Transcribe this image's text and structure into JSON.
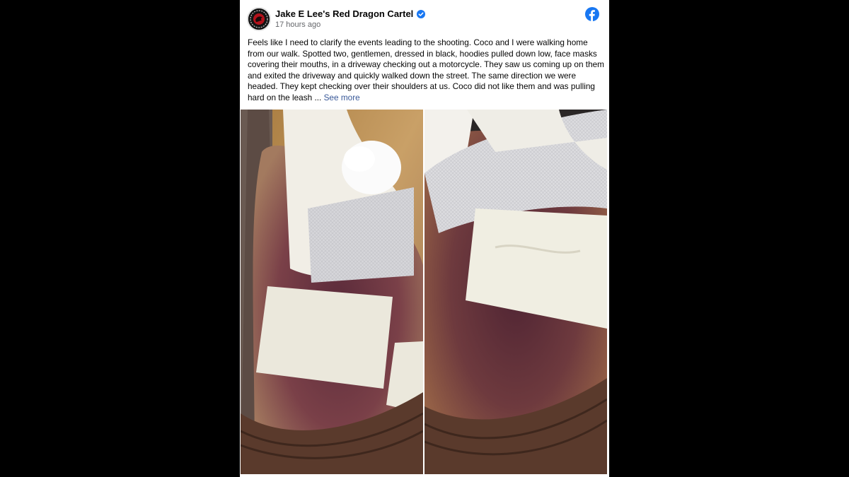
{
  "post": {
    "author": "Jake E Lee's Red Dragon Cartel",
    "timestamp": "17 hours ago",
    "text": "Feels like I need to clarify the events leading to the shooting. Coco and I were walking home from our walk. Spotted two, gentlemen, dressed in black, hoodies pulled down low, face masks covering their mouths, in a driveway checking out a motorcycle. They saw us coming up on them and exited the driveway and quickly walked down the street. The same direction we were headed. They kept checking over their shoulders at us. Coco did not like them and was pulling hard on the leash ... ",
    "see_more": "See more"
  },
  "icons": {
    "verified": "verified-badge-icon",
    "logo": "facebook-icon",
    "avatar": "band-logo-avatar"
  },
  "colors": {
    "facebook_blue": "#1877f2",
    "link_blue": "#385898",
    "muted_text": "#65676b"
  },
  "photos": [
    {
      "name": "wound-photo-left"
    },
    {
      "name": "wound-photo-right"
    }
  ]
}
